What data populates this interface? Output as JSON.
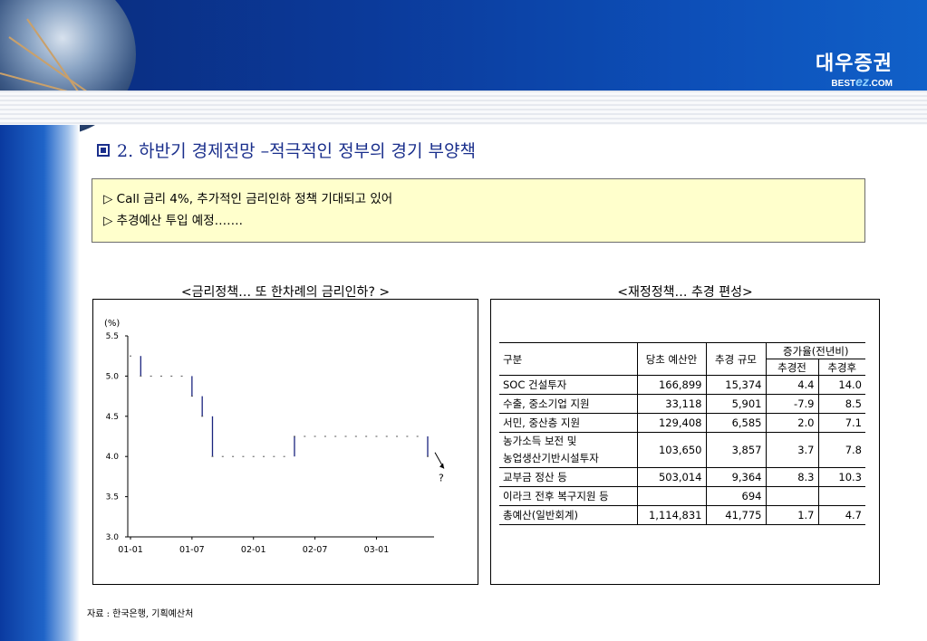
{
  "header": {
    "logo_main": "대우증권",
    "logo_sub_prefix": "BEST",
    "logo_sub_ez": "ez",
    "logo_sub_suffix": ".COM"
  },
  "section": {
    "number_title": "2. 하반기 경제전망 –적극적인 정부의 경기 부양책"
  },
  "summary": {
    "line1": "▷ Call 금리 4%, 추가적인 금리인하 정책 기대되고 있어",
    "line2": "▷ 추경예산 투입 예정……."
  },
  "left_chart": {
    "heading": "<금리정책… 또 한차례의 금리인하? >",
    "question_mark": "?"
  },
  "right_panel": {
    "heading": "<재정정책… 추경 편성>"
  },
  "chart_data": {
    "type": "line",
    "title": "",
    "ylabel": "(%)",
    "ylim": [
      3.0,
      5.5
    ],
    "yticks": [
      "5.5",
      "5.0",
      "4.5",
      "4.0",
      "3.5",
      "3.0"
    ],
    "xticks": [
      "01-01",
      "01-07",
      "02-01",
      "02-07",
      "03-01"
    ],
    "x": [
      "01-01",
      "01-02",
      "01-03",
      "01-04",
      "01-05",
      "01-06",
      "01-07",
      "01-08",
      "01-09",
      "01-10",
      "01-11",
      "01-12",
      "02-01",
      "02-02",
      "02-03",
      "02-04",
      "02-05",
      "02-06",
      "02-07",
      "02-08",
      "02-09",
      "02-10",
      "02-11",
      "02-12",
      "03-01",
      "03-02",
      "03-03",
      "03-04",
      "03-05",
      "03-06"
    ],
    "series": [
      {
        "values": [
          5.25,
          5.0,
          5.0,
          5.0,
          5.0,
          5.0,
          4.75,
          4.5,
          4.0,
          4.0,
          4.0,
          4.0,
          4.0,
          4.0,
          4.0,
          4.0,
          4.25,
          4.25,
          4.25,
          4.25,
          4.25,
          4.25,
          4.25,
          4.25,
          4.25,
          4.25,
          4.25,
          4.25,
          4.25,
          4.0
        ]
      }
    ],
    "color": "#1a237e"
  },
  "table": {
    "headers": {
      "category": "구분",
      "budget": "당초 예산안",
      "supplementary": "추경 규모",
      "growth": "증가율(전년비)",
      "before": "추경전",
      "after": "추경후"
    },
    "rows": [
      {
        "label": "SOC 건설투자",
        "budget": "166,899",
        "supp": "15,374",
        "before": "4.4",
        "after": "14.0"
      },
      {
        "label": "수출, 중소기업 지원",
        "budget": "33,118",
        "supp": "5,901",
        "before": "-7.9",
        "after": "8.5"
      },
      {
        "label": "서민, 중산층 지원",
        "budget": "129,408",
        "supp": "6,585",
        "before": "2.0",
        "after": "7.1"
      },
      {
        "label": "농가소득 보전 및",
        "label2": "농업생산기반시설투자",
        "budget": "103,650",
        "supp": "3,857",
        "before": "3.7",
        "after": "7.8"
      },
      {
        "label": "교부금 정산 등",
        "budget": "503,014",
        "supp": "9,364",
        "before": "8.3",
        "after": "10.3"
      },
      {
        "label": "이라크 전후 복구지원 등",
        "budget": "",
        "supp": "694",
        "before": "",
        "after": ""
      },
      {
        "label": "총예산(일반회계)",
        "budget": "1,114,831",
        "supp": "41,775",
        "before": "1.7",
        "after": "4.7"
      }
    ]
  },
  "source": "자료 : 한국은행, 기획예산처"
}
